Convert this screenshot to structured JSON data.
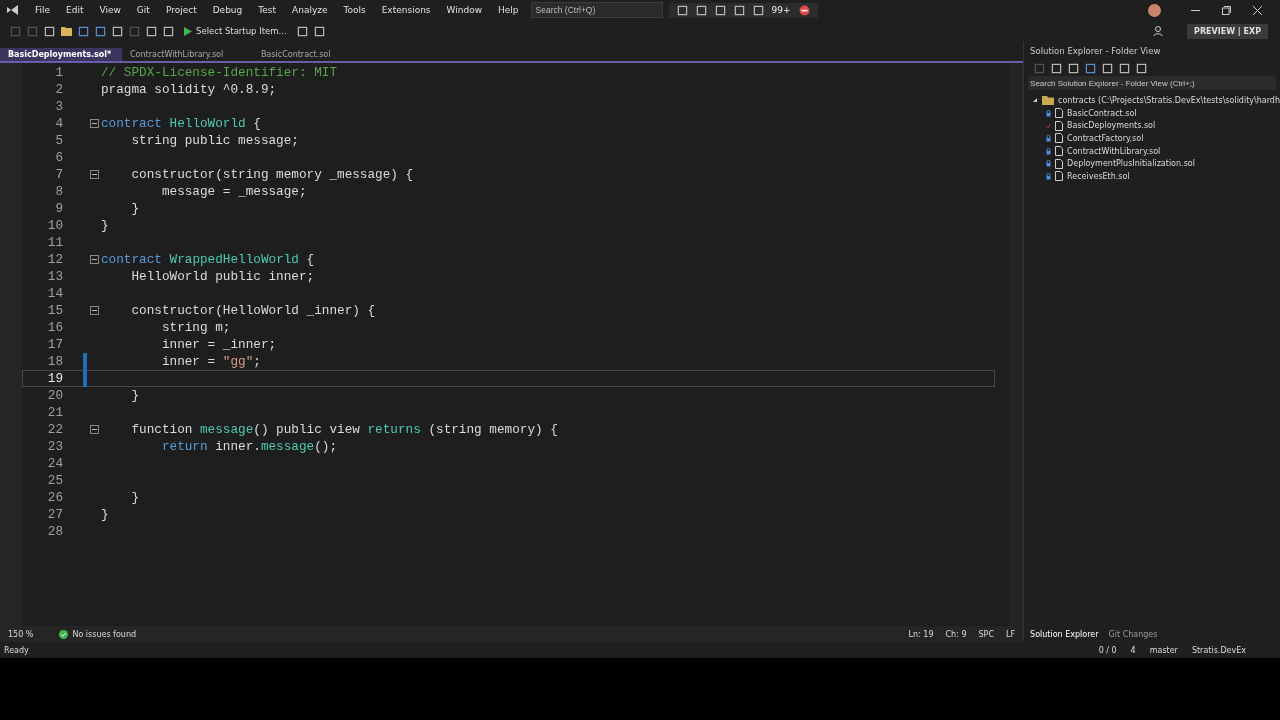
{
  "menu": [
    "File",
    "Edit",
    "View",
    "Git",
    "Project",
    "Debug",
    "Test",
    "Analyze",
    "Tools",
    "Extensions",
    "Window",
    "Help"
  ],
  "search": {
    "placeholder": "Search (Ctrl+Q)"
  },
  "recorder": {
    "badge": "99+"
  },
  "toolbar": {
    "startup": "Select Startup Item...",
    "preview_badge": "PREVIEW | EXP"
  },
  "tabs": [
    {
      "label": "BasicDeployments.sol*",
      "selected": true
    },
    {
      "label": "ContractWithLibrary.sol",
      "selected": false
    },
    {
      "label": "BasicContract.sol",
      "selected": false
    }
  ],
  "editor": {
    "lines": [
      {
        "number": "1",
        "fold": false,
        "modified": false,
        "selected": false,
        "tokens": [
          {
            "text": "// SPDX-License-Identifier: MIT",
            "kind": "comment"
          }
        ]
      },
      {
        "number": "2",
        "fold": false,
        "modified": false,
        "selected": false,
        "tokens": [
          {
            "text": "pragma solidity ^0.8.9;",
            "kind": "plain"
          }
        ]
      },
      {
        "number": "3",
        "fold": false,
        "modified": false,
        "selected": false
      },
      {
        "number": "4",
        "fold": true,
        "modified": false,
        "selected": false,
        "tokens": [
          {
            "text": "contract",
            "kind": "keyword"
          },
          {
            "text": " HelloWorld",
            "kind": "type"
          },
          {
            "text": " {",
            "kind": "plain"
          }
        ]
      },
      {
        "number": "5",
        "fold": false,
        "modified": false,
        "selected": false,
        "tokens": [
          {
            "text": "    string public message;",
            "kind": "plain"
          }
        ]
      },
      {
        "number": "6",
        "fold": false,
        "modified": false,
        "selected": false
      },
      {
        "number": "7",
        "fold": true,
        "modified": false,
        "selected": false,
        "tokens": [
          {
            "text": "    constructor(string memory _message) {",
            "kind": "plain"
          }
        ]
      },
      {
        "number": "8",
        "fold": false,
        "modified": false,
        "selected": false,
        "tokens": [
          {
            "text": "        message = _message;",
            "kind": "plain"
          }
        ]
      },
      {
        "number": "9",
        "fold": false,
        "modified": false,
        "selected": false,
        "tokens": [
          {
            "text": "    }",
            "kind": "plain"
          }
        ]
      },
      {
        "number": "10",
        "fold": false,
        "modified": false,
        "selected": false,
        "tokens": [
          {
            "text": "}",
            "kind": "plain"
          }
        ]
      },
      {
        "number": "11",
        "fold": false,
        "modified": false,
        "selected": false
      },
      {
        "number": "12",
        "fold": true,
        "modified": false,
        "selected": false,
        "tokens": [
          {
            "text": "contract",
            "kind": "keyword"
          },
          {
            "text": " WrappedHelloWorld",
            "kind": "type"
          },
          {
            "text": " {",
            "kind": "plain"
          }
        ]
      },
      {
        "number": "13",
        "fold": false,
        "modified": false,
        "selected": false,
        "tokens": [
          {
            "text": "    HelloWorld public inner;",
            "kind": "plain"
          }
        ]
      },
      {
        "number": "14",
        "fold": false,
        "modified": false,
        "selected": false
      },
      {
        "number": "15",
        "fold": true,
        "modified": false,
        "selected": false,
        "tokens": [
          {
            "text": "    constructor(HelloWorld _inner) {",
            "kind": "plain"
          }
        ]
      },
      {
        "number": "16",
        "fold": false,
        "modified": false,
        "selected": false,
        "tokens": [
          {
            "text": "        string m;",
            "kind": "plain"
          }
        ]
      },
      {
        "number": "17",
        "fold": false,
        "modified": false,
        "selected": false,
        "tokens": [
          {
            "text": "        inner = _inner;",
            "kind": "plain"
          }
        ]
      },
      {
        "number": "18",
        "fold": false,
        "modified": true,
        "selected": false,
        "tokens": [
          {
            "text": "        inner = ",
            "kind": "plain"
          },
          {
            "text": "\"gg\"",
            "kind": "string"
          },
          {
            "text": ";",
            "kind": "plain"
          }
        ]
      },
      {
        "number": "19",
        "fold": false,
        "modified": true,
        "selected": true
      },
      {
        "number": "20",
        "fold": false,
        "modified": false,
        "selected": false,
        "tokens": [
          {
            "text": "    }",
            "kind": "plain"
          }
        ]
      },
      {
        "number": "21",
        "fold": false,
        "modified": false,
        "selected": false
      },
      {
        "number": "22",
        "fold": true,
        "modified": false,
        "selected": false,
        "tokens": [
          {
            "text": "    function ",
            "kind": "plain"
          },
          {
            "text": "message",
            "kind": "func"
          },
          {
            "text": "() public view ",
            "kind": "plain"
          },
          {
            "text": "returns",
            "kind": "func"
          },
          {
            "text": " (string memory) {",
            "kind": "plain"
          }
        ]
      },
      {
        "number": "23",
        "fold": false,
        "modified": false,
        "selected": false,
        "tokens": [
          {
            "text": "        return",
            "kind": "keyword"
          },
          {
            "text": " inner.",
            "kind": "plain"
          },
          {
            "text": "message",
            "kind": "func"
          },
          {
            "text": "();",
            "kind": "plain"
          }
        ]
      },
      {
        "number": "24",
        "fold": false,
        "modified": false,
        "selected": false
      },
      {
        "number": "25",
        "fold": false,
        "modified": false,
        "selected": false
      },
      {
        "number": "26",
        "fold": false,
        "modified": false,
        "selected": false,
        "tokens": [
          {
            "text": "    }",
            "kind": "plain"
          }
        ]
      },
      {
        "number": "27",
        "fold": false,
        "modified": false,
        "selected": false,
        "tokens": [
          {
            "text": "}",
            "kind": "plain"
          }
        ]
      },
      {
        "number": "28",
        "fold": false,
        "modified": false,
        "selected": false
      }
    ]
  },
  "editor_status": {
    "zoom": "150 %",
    "issues": "No issues found",
    "line": "Ln: 19",
    "column": "Ch: 9",
    "spacing": "SPC",
    "line_ending": "LF"
  },
  "solution_explorer": {
    "title": "Solution Explorer - Folder View",
    "search": {
      "placeholder": "Search Solution Explorer - Folder View (Ctrl+;)"
    },
    "tree": [
      {
        "label": "contracts (C:\\Projects\\Stratis.DevEx\\tests\\solidity\\hardh",
        "expanded": true,
        "children": [
          {
            "label": "BasicContract.sol",
            "kind": "locked"
          },
          {
            "label": "BasicDeployments.sol",
            "kind": "edited"
          },
          {
            "label": "ContractFactory.sol",
            "kind": "locked"
          },
          {
            "label": "ContractWithLibrary.sol",
            "kind": "locked"
          },
          {
            "label": "DeploymentPlusInitialization.sol",
            "kind": "locked"
          },
          {
            "label": "ReceivesEth.sol",
            "kind": "locked"
          }
        ]
      }
    ],
    "tabs": [
      {
        "label": "Solution Explorer",
        "selected": true
      },
      {
        "label": "Git Changes",
        "selected": false
      }
    ]
  },
  "status_bar": {
    "message": "Ready",
    "sync": "0 / 0",
    "edits": "4",
    "branch": "master",
    "repository": "Stratis.DevEx"
  }
}
